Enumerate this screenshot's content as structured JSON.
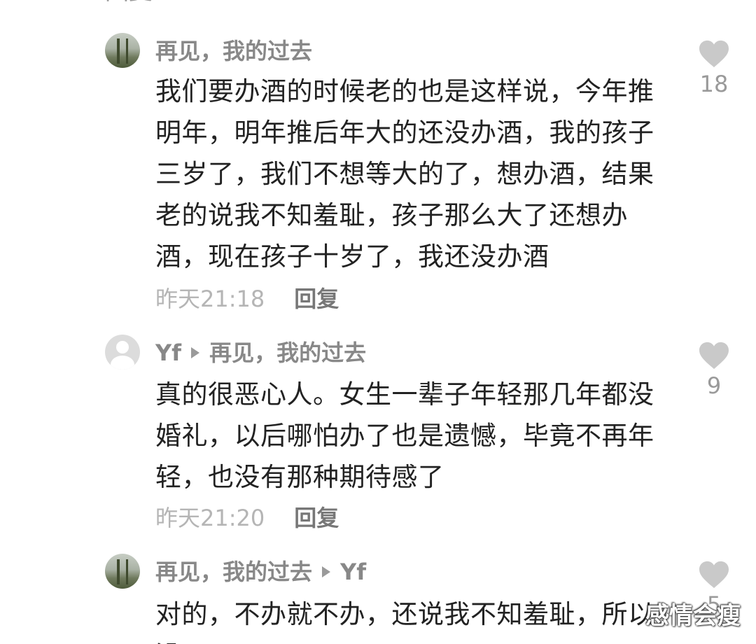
{
  "top_cut_text": "回复",
  "replies": [
    {
      "author": "再见，我的过去",
      "reply_to": "",
      "content": "我们要办酒的时候老的也是这样说，今年推明年，明年推后年大的还没办酒，我的孩子三岁了，我们不想等大的了，想办酒，结果老的说我不知羞耻，孩子那么大了还想办酒，现在孩子十岁了，我还没办酒",
      "time": "昨天21:18",
      "reply_label": "回复",
      "likes": "18",
      "avatar": "photo-avatar"
    },
    {
      "author": "Yf",
      "reply_to": "再见，我的过去",
      "content": "真的很恶心人。女生一辈子年轻那几年都没婚礼，以后哪怕办了也是遗憾，毕竟不再年轻，也没有那种期待感了",
      "time": "昨天21:20",
      "reply_label": "回复",
      "likes": "9",
      "avatar": "default-user-avatar"
    },
    {
      "author": "再见，我的过去",
      "reply_to": "Yf",
      "content": "对的，不办就不办，还说我不知羞耻，所以没",
      "likes": "5",
      "avatar": "photo-avatar"
    }
  ],
  "watermark": "感情会瘦",
  "colors": {
    "like_heart": "#c9c9c9",
    "name": "#888888",
    "content": "#222222",
    "time": "#b5b5b5"
  }
}
